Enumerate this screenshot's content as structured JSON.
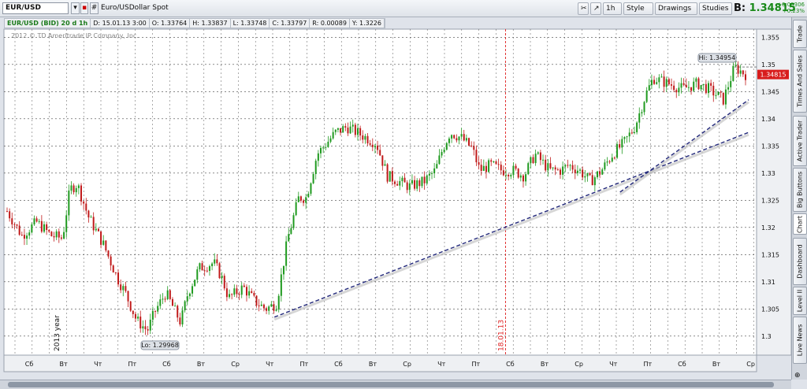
{
  "toolbar": {
    "symbol": "EUR/USD",
    "description": "Euro/USDollar Spot",
    "interval": "1h",
    "style": "Style",
    "drawings": "Drawings",
    "studies": "Studies",
    "bid_label": "B:",
    "bid_value": "1.34815",
    "change1": "+0.00306",
    "change2": "+0.23%"
  },
  "infobar": {
    "name": "EUR/USD (BID) 20 d 1h",
    "date": "D: 15.01.13 3:00",
    "open": "O: 1.33764",
    "high": "H: 1.33837",
    "low": "L: 1.33748",
    "close": "C: 1.33797",
    "range": "R: 0.00089",
    "y": "Y: 1.3226"
  },
  "copyright": "2012 © TD Ameritrade IP Company, Inc.",
  "side_tabs": [
    "Trade",
    "Times And Sales",
    "Active Trader",
    "Big Buttons",
    "Chart",
    "Dashboard",
    "Level II",
    "Live News"
  ],
  "colors": {
    "up": "#1f9a1f",
    "down": "#c01a1a",
    "trendline": "#22287a",
    "marker": "#e02020"
  },
  "chart_data": {
    "type": "candlestick",
    "ylim": [
      1.2965,
      1.3565
    ],
    "y_ticks": [
      "1.355",
      "1.35",
      "1.345",
      "1.34",
      "1.335",
      "1.33",
      "1.325",
      "1.32",
      "1.315",
      "1.31",
      "1.305",
      "1.3"
    ],
    "x_ticks": [
      "Сб",
      "Вт",
      "Чт",
      "Пт",
      "Сб",
      "Вт",
      "Ср",
      "Чт",
      "Пт",
      "Сб",
      "Вт",
      "Ср",
      "Чт",
      "Пт",
      "Сб",
      "Вт",
      "Ср",
      "Чт",
      "Пт",
      "Сб",
      "Вт",
      "Ср"
    ],
    "hi_label": "Hi: 1.34954",
    "lo_label": "Lo: 1.29968",
    "last_price": "1.34815",
    "last_value": 1.34815,
    "hi_value": 1.34954,
    "lo_value": 1.29968,
    "year_label": "2013 year",
    "date_marker": "18.01.13",
    "path": [
      [
        0,
        1.323
      ],
      [
        0.02,
        1.3185
      ],
      [
        0.04,
        1.321
      ],
      [
        0.06,
        1.3185
      ],
      [
        0.075,
        1.318
      ],
      [
        0.085,
        1.327
      ],
      [
        0.095,
        1.328
      ],
      [
        0.11,
        1.322
      ],
      [
        0.13,
        1.317
      ],
      [
        0.15,
        1.3105
      ],
      [
        0.16,
        1.308
      ],
      [
        0.175,
        1.303
      ],
      [
        0.19,
        1.301
      ],
      [
        0.2,
        1.3045
      ],
      [
        0.215,
        1.308
      ],
      [
        0.235,
        1.3025
      ],
      [
        0.245,
        1.308
      ],
      [
        0.26,
        1.3125
      ],
      [
        0.28,
        1.3135
      ],
      [
        0.29,
        1.311
      ],
      [
        0.3,
        1.307
      ],
      [
        0.32,
        1.309
      ],
      [
        0.335,
        1.3065
      ],
      [
        0.35,
        1.305
      ],
      [
        0.365,
        1.306
      ],
      [
        0.38,
        1.318
      ],
      [
        0.395,
        1.3255
      ],
      [
        0.405,
        1.3255
      ],
      [
        0.42,
        1.3335
      ],
      [
        0.445,
        1.3375
      ],
      [
        0.46,
        1.3385
      ],
      [
        0.48,
        1.337
      ],
      [
        0.5,
        1.3355
      ],
      [
        0.515,
        1.3295
      ],
      [
        0.53,
        1.3285
      ],
      [
        0.545,
        1.3275
      ],
      [
        0.565,
        1.3285
      ],
      [
        0.58,
        1.3305
      ],
      [
        0.59,
        1.3345
      ],
      [
        0.6,
        1.3375
      ],
      [
        0.615,
        1.3365
      ],
      [
        0.63,
        1.3345
      ],
      [
        0.64,
        1.3305
      ],
      [
        0.655,
        1.3315
      ],
      [
        0.67,
        1.3305
      ],
      [
        0.685,
        1.3305
      ],
      [
        0.7,
        1.3295
      ],
      [
        0.715,
        1.3335
      ],
      [
        0.735,
        1.3305
      ],
      [
        0.75,
        1.3305
      ],
      [
        0.76,
        1.3315
      ],
      [
        0.775,
        1.3305
      ],
      [
        0.79,
        1.3285
      ],
      [
        0.805,
        1.3305
      ],
      [
        0.82,
        1.3335
      ],
      [
        0.835,
        1.3355
      ],
      [
        0.85,
        1.3385
      ],
      [
        0.865,
        1.3445
      ],
      [
        0.875,
        1.3475
      ],
      [
        0.895,
        1.3465
      ],
      [
        0.915,
        1.3455
      ],
      [
        0.935,
        1.3465
      ],
      [
        0.95,
        1.3455
      ],
      [
        0.97,
        1.3435
      ],
      [
        0.985,
        1.3495
      ],
      [
        1,
        1.3482
      ]
    ],
    "trendlines": [
      [
        [
          0.362,
          1.3035
        ],
        [
          1,
          1.3375
        ]
      ],
      [
        [
          0.83,
          1.3265
        ],
        [
          1,
          1.3435
        ]
      ]
    ]
  }
}
